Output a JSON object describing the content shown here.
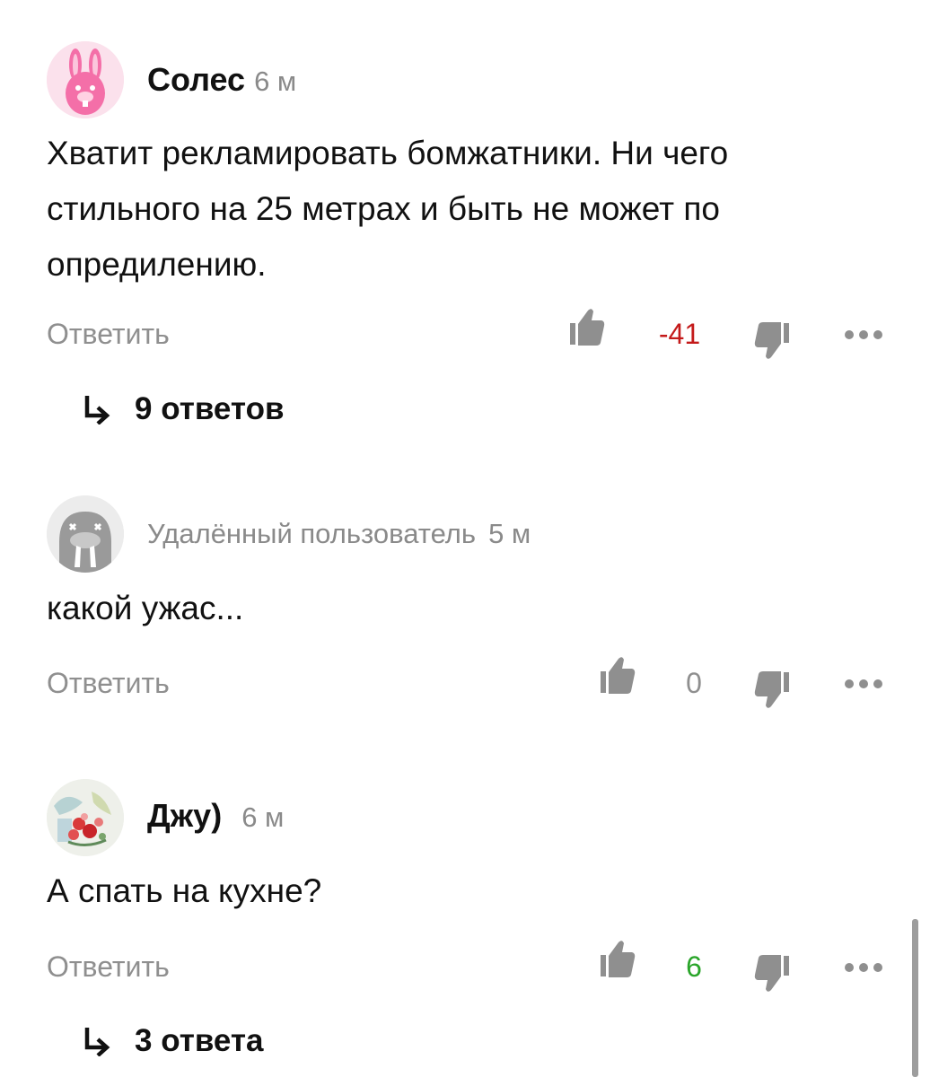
{
  "comments": [
    {
      "author": "Солес",
      "time": "6 м",
      "text": "Хватит рекламировать бомжатники. Ни чего стильного на 25 метрах и быть не может по опредилению.",
      "reply_label": "Ответить",
      "score": "-41",
      "score_color": "#c41a1a",
      "replies": "9 ответов",
      "avatar": "pink-rabbit-avatar"
    },
    {
      "author": "Удалённый пользователь",
      "time": "5 м",
      "text": "какой ужас...",
      "reply_label": "Ответить",
      "score": "0",
      "score_color": "#8f8f8f",
      "avatar": "walrus-avatar"
    },
    {
      "author": "Джу)",
      "time": "6 м",
      "text": "А спать на кухне?",
      "reply_label": "Ответить",
      "score": "6",
      "score_color": "#2aa52a",
      "replies": "3 ответа",
      "avatar": "flowers-photo-avatar"
    }
  ],
  "icons": {
    "like": "thumbs-up-icon",
    "dislike": "thumbs-down-icon",
    "more": "more-dots-icon",
    "reply_arrow": "reply-arrow-icon"
  }
}
